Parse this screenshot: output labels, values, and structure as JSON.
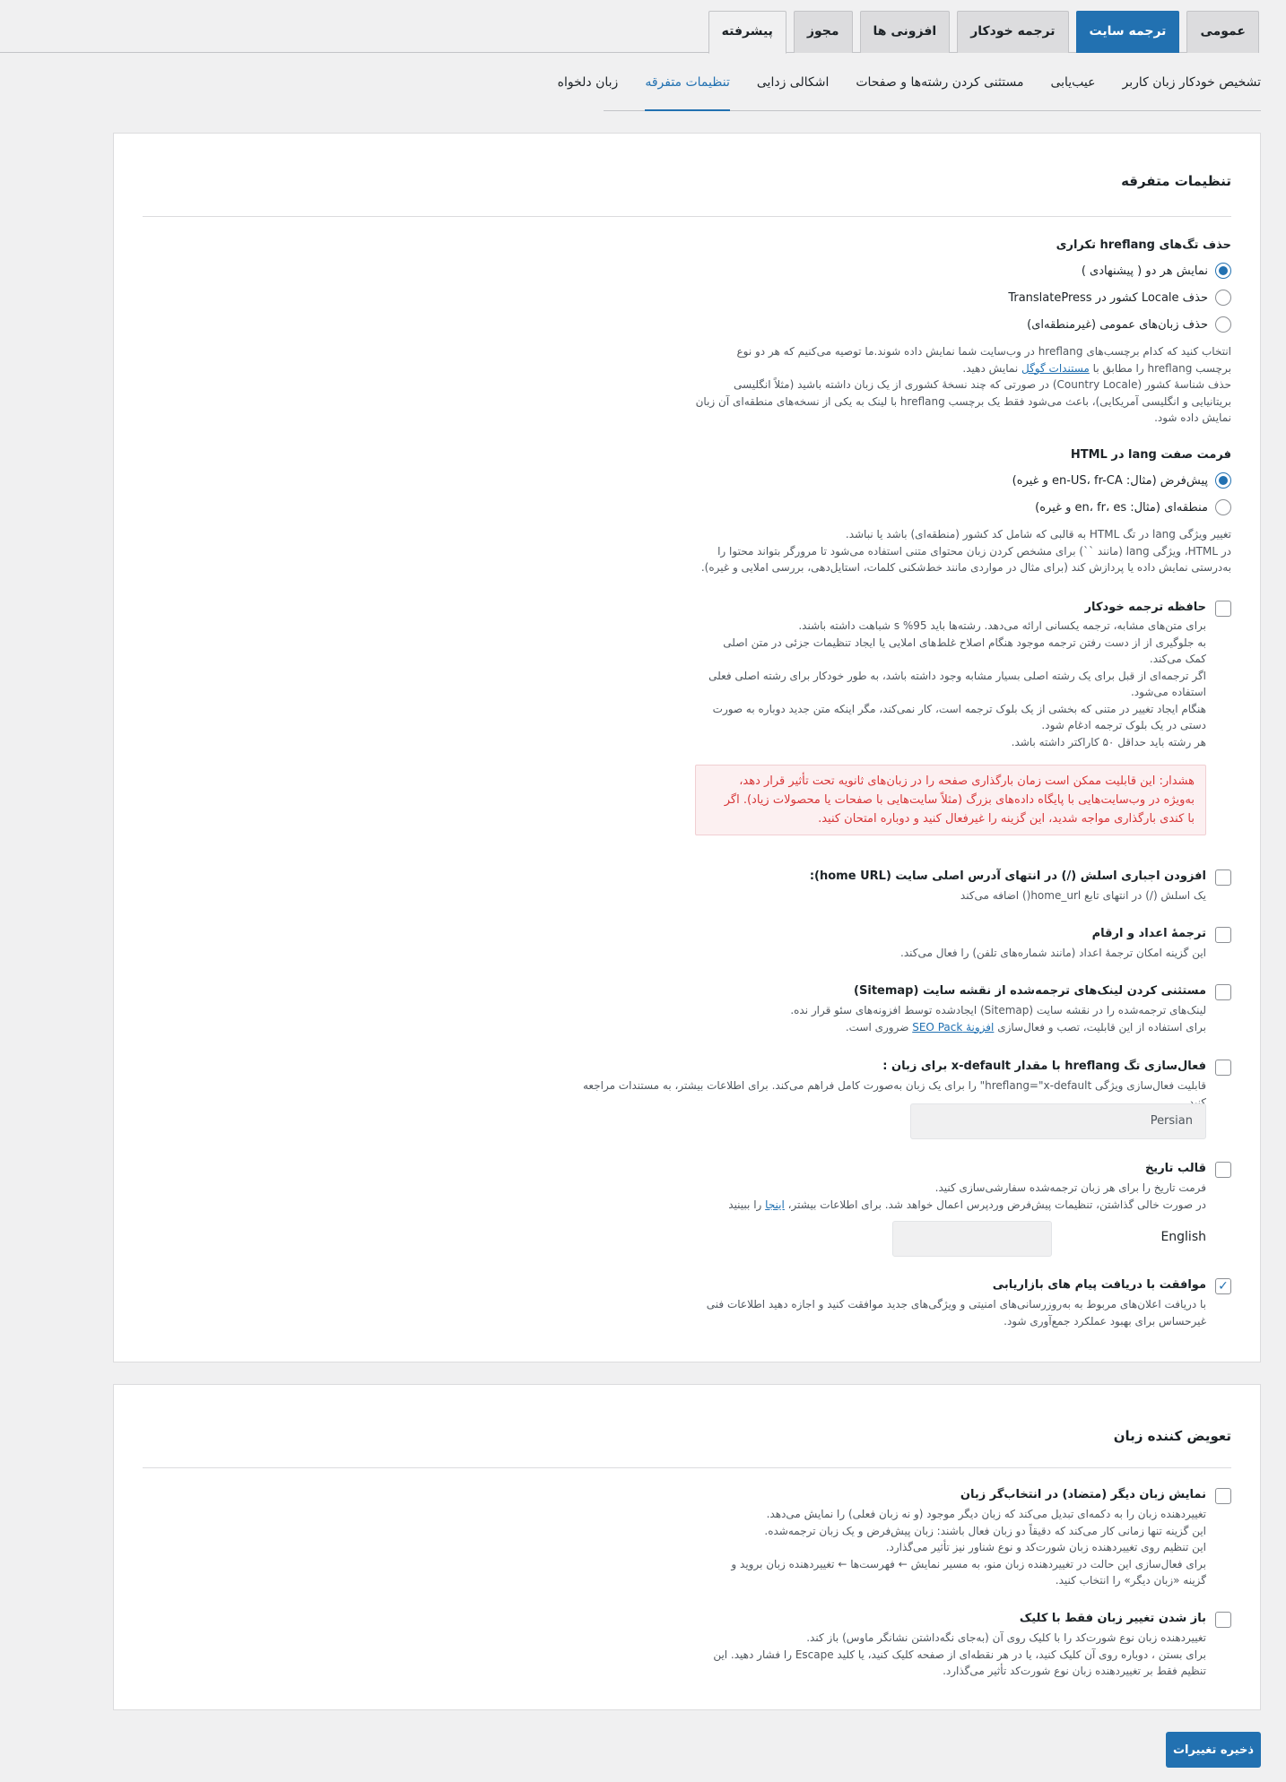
{
  "tabs": {
    "main": [
      "عمومی",
      "ترجمه سایت",
      "ترجمه خودکار",
      "افزونی ها",
      "مجوز",
      "پیشرفته"
    ],
    "sub": [
      "تشخیص خودکار زبان کاربر",
      "عیب‌یابی",
      "مستثنی کردن رشته‌ها و صفحات",
      "اشکالی زدایی",
      "تنظیمات متفرقه",
      "زبان دلخواه"
    ]
  },
  "misc": {
    "title": "تنظیمات متفرقه",
    "hreflang": {
      "label": "حذف تگ‌های hreflang تکراری",
      "options": [
        "نمایش هر دو ( پیشنهادی )",
        "حذف Locale کشور در TranslatePress",
        "حذف زبان‌های عمومی (غیرمنطقه‌ای)"
      ],
      "desc1": "انتخاب کنید که کدام برچسب‌های hreflang در وب‌سایت شما نمایش داده شوند.ما توصیه می‌کنیم که هر دو نوع",
      "desc2a": "برچسب hreflang را مطابق با ",
      "desc2link": "مستندات گوگل",
      "desc2b": " نمایش دهید.",
      "desc3": "حذف شناسهٔ کشور (Country Locale) در صورتی که چند نسخهٔ کشوری از یک زبان داشته باشید (مثلاً انگلیسی",
      "desc4": "بریتانیایی و انگلیسی آمریکایی)، باعث می‌شود فقط یک برچسب hreflang با لینک به یکی از نسخه‌های منطقه‌ای آن زبان",
      "desc5": "نمایش داده شود."
    },
    "lang_attr": {
      "label": "فرمت صفت lang در HTML",
      "options": [
        "پیش‌فرض (مثال: en-US، fr-CA و غیره)",
        "منطقه‌ای (مثال: en، fr، es و غیره)"
      ],
      "desc1": "تغییر ویژگی lang در تگ HTML به قالبی که شامل کد کشور (منطقه‌ای) باشد یا نباشد.",
      "desc2": "در HTML، ویژگی lang (مانند ``) برای مشخص کردن زبان محتوای متنی استفاده می‌شود تا مرورگر بتواند محتوا را",
      "desc3": "به‌درستی نمایش داده یا پردازش کند (برای مثال در مواردی مانند خط‌شکنی کلمات، استایل‌دهی، بررسی املایی و غیره)."
    },
    "memory": {
      "label": "حافظه ترجمه خودکار",
      "lines": [
        "برای متن‌های مشابه، ترجمه یکسانی ارائه می‌دهد. رشته‌ها باید 95% s شباهت داشته باشند.",
        "به جلوگیری از از دست رفتن ترجمه موجود هنگام اصلاح غلط‌های املایی یا ایجاد تنظیمات جزئی در متن اصلی",
        "کمک می‌کند.",
        "اگر ترجمه‌ای از قبل برای یک رشته اصلی بسیار مشابه وجود داشته باشد، به طور خودکار برای رشته اصلی فعلی",
        "استفاده می‌شود.",
        "هنگام ایجاد تغییر در متنی که بخشی از یک بلوک ترجمه است، کار نمی‌کند، مگر اینکه متن جدید دوباره به صورت",
        "دستی در یک بلوک ترجمه ادغام شود.",
        "هر رشته باید حداقل ۵۰ کاراکتر داشته باشد."
      ],
      "warning": [
        "هشدار: این قابلیت ممکن است زمان بارگذاری صفحه را در زبان‌های ثانویه تحت تأثیر قرار دهد،",
        "به‌ویژه در وب‌سایت‌هایی با پایگاه داده‌های بزرگ (مثلاً سایت‌هایی با صفحات یا محصولات زیاد). اگر",
        "با کندی بارگذاری مواجه شدید، این گزینه را غیرفعال کنید و دوباره امتحان کنید."
      ]
    },
    "slash": {
      "label": "افزودن اجباری اسلش (/) در انتهای آدرس اصلی سایت (home URL):",
      "desc": "یک اسلش (/) در انتهای تابع home_url() اضافه می‌کند"
    },
    "numbers": {
      "label": "ترجمهٔ اعداد و ارقام",
      "desc": "این گزینه امکان ترجمهٔ اعداد (مانند شماره‌های تلفن) را فعال می‌کند."
    },
    "sitemap": {
      "label": "مستثنی کردن لینک‌های ترجمه‌شده از نقشه سایت (Sitemap)",
      "desc1": "لینک‌های ترجمه‌شده را در نقشه سایت (Sitemap) ایجادشده توسط افزونه‌های سئو قرار نده.",
      "desc2a": "برای استفاده از این قابلیت، تصب و فعال‌سازی ",
      "desc2link": "افزونهٔ SEO Pack",
      "desc2b": " ضروری است."
    },
    "xdefault": {
      "label": "فعال‌سازی تگ hreflang با مقدار x-default برای زبان :",
      "desc": "قابلیت فعال‌سازی ویژگی hreflang=\"x-default\" را برای یک زبان به‌صورت کامل فراهم می‌کند. برای اطلاعات بیشتر، به مستندات مراجعه کنید.",
      "value": "Persian"
    },
    "date": {
      "label": "قالب تاریخ",
      "desc1": "فرمت تاریخ را برای هر زبان ترجمه‌شده سفارشی‌سازی کنید.",
      "desc2a": "در صورت خالی گذاشتن، تنظیمات پیش‌فرض وردپرس اعمال خواهد شد. برای اطلاعات بیشتر، ",
      "desc2link": "اینجا",
      "desc2b": " را ببینید",
      "language": "English",
      "value": ""
    },
    "marketing": {
      "label": "موافقت با دریافت پیام های بازاریابی",
      "desc1": "با دریافت اعلان‌های مربوط به به‌روزرسانی‌های امنیتی و ویژگی‌های جدید موافقت کنید و اجازه دهید اطلاعات فنی",
      "desc2": "غیرحساس برای بهبود عملکرد جمع‌آوری شود."
    }
  },
  "switcher": {
    "title": "تعویض کننده زبان",
    "opposite": {
      "label": "نمایش زبان دیگر (متضاد) در انتخاب‌گر زبان",
      "lines": [
        "تغییردهنده زبان را به دکمه‌ای تبدیل می‌کند که زبان دیگر موجود (و نه زبان فعلی) را نمایش می‌دهد.",
        "این گزینه تنها زمانی کار می‌کند که دقیقاً دو زبان فعال باشند: زبان پیش‌فرض و یک زبان ترجمه‌شده.",
        "این تنظیم روی تغییردهنده زبان شورت‌کد و نوع شناور نیز تأثیر می‌گذارد.",
        "برای فعال‌سازی این حالت در تغییردهنده زبان منو، به مسیر نمایش ← فهرست‌ها ← تغییردهنده زبان بروید و",
        "گزینه «زبان دیگر» را انتخاب کنید."
      ]
    },
    "click": {
      "label": "باز شدن تغییر زبان فقط با کلیک",
      "lines": [
        "تغییردهنده زبان نوع شورت‌کد را با کلیک روی آن (به‌جای نگه‌داشتن نشانگر ماوس) باز کند.",
        "برای بستن ، دوباره روی آن کلیک کنید، یا در هر نقطه‌ای از صفحه کلیک کنید، یا کلید Escape را فشار دهید. این",
        "تنظیم فقط بر تغییردهنده زبان نوع شورت‌کد تأثیر می‌گذارد."
      ]
    }
  },
  "save_label": "ذخیره تغییرات",
  "colors": {
    "accent": "#2271b1",
    "warning_bg": "#fcf0f1",
    "warning_text": "#d63638"
  }
}
